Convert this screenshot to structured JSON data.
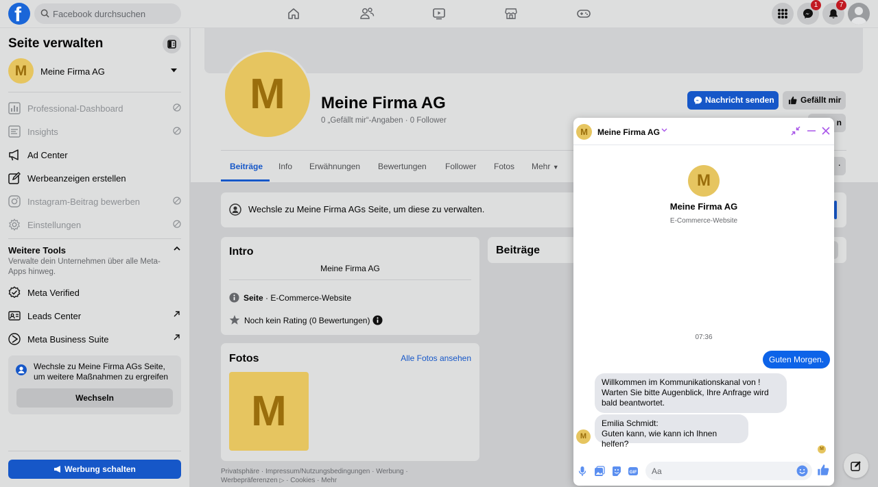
{
  "topbar": {
    "logo_letter": "f",
    "search_placeholder": "Facebook durchsuchen",
    "nav_icons": [
      "home-icon",
      "friends-icon",
      "watch-icon",
      "marketplace-icon",
      "gaming-icon"
    ],
    "messenger_badge": "1",
    "notifications_badge": "7"
  },
  "sidebar": {
    "title": "Seite verwalten",
    "page_avatar_letter": "M",
    "page_name": "Meine Firma AG",
    "items": [
      {
        "label": "Professional-Dashboard",
        "icon": "dashboard-icon",
        "disabled": true
      },
      {
        "label": "Insights",
        "icon": "insights-icon",
        "disabled": true
      },
      {
        "label": "Ad Center",
        "icon": "megaphone-icon",
        "disabled": false
      },
      {
        "label": "Werbeanzeigen erstellen",
        "icon": "edit-icon",
        "disabled": false
      },
      {
        "label": "Instagram-Beitrag bewerben",
        "icon": "instagram-icon",
        "disabled": true
      },
      {
        "label": "Einstellungen",
        "icon": "gear-icon",
        "disabled": true
      }
    ],
    "tools_heading": "Weitere Tools",
    "tools_description": "Verwalte dein Unternehmen über alle Meta-Apps hinweg.",
    "tools": [
      {
        "label": "Meta Verified",
        "icon": "verified-icon",
        "external": false
      },
      {
        "label": "Leads Center",
        "icon": "leads-icon",
        "external": true
      },
      {
        "label": "Meta Business Suite",
        "icon": "business-suite-icon",
        "external": true
      }
    ],
    "switch_box_text": "Wechsle zu Meine Firma AGs Seite, um weitere Maßnahmen zu ergreifen",
    "switch_button": "Wechseln",
    "ad_button": "Werbung schalten"
  },
  "page": {
    "avatar_letter": "M",
    "name": "Meine Firma AG",
    "stats": "0 „Gefällt mir“-Angaben · 0 Follower",
    "message_button": "Nachricht senden",
    "like_button": "Gefällt mir",
    "tabs": [
      "Beiträge",
      "Info",
      "Erwähnungen",
      "Bewertungen",
      "Follower",
      "Fotos",
      "Mehr"
    ],
    "active_tab": "Beiträge",
    "switch_bar": "Wechsle zu Meine Firma AGs Seite, um diese zu verwalten.",
    "intro": {
      "heading": "Intro",
      "page_name": "Meine Firma AG",
      "category_label": "Seite",
      "category": " · E-Commerce-Website",
      "rating": "Noch kein Rating (0 Bewertungen)"
    },
    "photos": {
      "heading": "Fotos",
      "link": "Alle Fotos ansehen",
      "thumb_letter": "M"
    },
    "posts_heading": "Beiträge",
    "footer_line1": "Privatsphäre · Impressum/Nutzungsbedingungen · Werbung ·",
    "footer_prefs": "Werbepräferenzen",
    "footer_line2": " · Cookies · Mehr"
  },
  "chat": {
    "avatar_letter": "M",
    "name": "Meine Firma AG",
    "profile_name": "Meine Firma AG",
    "profile_subtitle": "E-Commerce-Website",
    "timestamp": "07:36",
    "outgoing": "Guten Morgen.",
    "incoming": [
      "Willkommen im Kommunikationskanal von ! Warten Sie bitte Augenblick, Ihre Anfrage wird bald beantwortet.",
      "Emilia Schmidt:\nGuten kann, wie kann ich Ihnen helfen?"
    ],
    "input_placeholder": "Aa",
    "accent": "#0d63e8"
  },
  "colors": {
    "brand_blue": "#1657c8",
    "avatar_yellow": "#e6c560",
    "avatar_letter": "#9a6e0c",
    "badge_red": "#c11a22"
  }
}
